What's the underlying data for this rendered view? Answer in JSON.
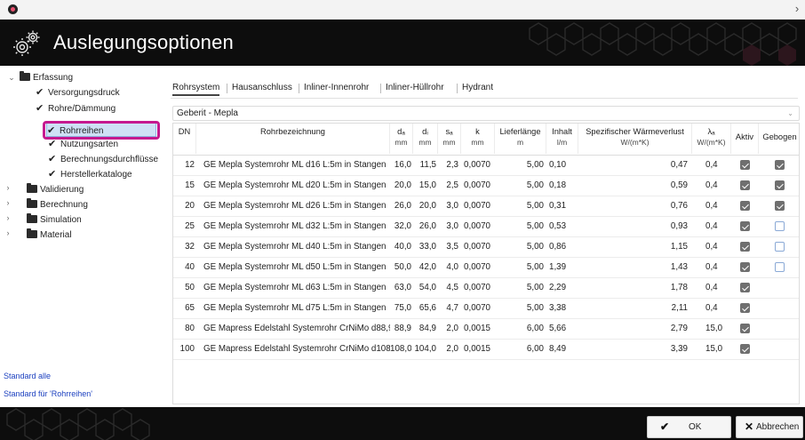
{
  "window": {
    "close_glyph": "›"
  },
  "header": {
    "title": "Auslegungsoptionen",
    "icon": "gears-icon"
  },
  "sidebar": {
    "tree": [
      {
        "label": "Erfassung",
        "type": "folder",
        "expanded": true,
        "level": 0
      },
      {
        "label": "Versorgungsdruck",
        "type": "check",
        "level": 1
      },
      {
        "label": "Rohre/Dämmung",
        "type": "check",
        "level": 1
      },
      {
        "label": "Rohrreihen",
        "type": "check",
        "level": 1,
        "selected": true
      },
      {
        "label": "Nutzungsarten",
        "type": "check",
        "level": 1
      },
      {
        "label": "Berechnungsdurchflüsse",
        "type": "check",
        "level": 1
      },
      {
        "label": "Herstellerkataloge",
        "type": "check",
        "level": 1
      },
      {
        "label": "Validierung",
        "type": "folder",
        "expanded": false,
        "level": 0
      },
      {
        "label": "Berechnung",
        "type": "folder",
        "expanded": false,
        "level": 0
      },
      {
        "label": "Simulation",
        "type": "folder",
        "expanded": false,
        "level": 0
      },
      {
        "label": "Material",
        "type": "folder",
        "expanded": false,
        "level": 0
      }
    ],
    "links": [
      "Standard alle",
      "Standard für 'Rohrreihen'"
    ]
  },
  "tabs": [
    "Rohrsystem",
    "Hausanschluss",
    "Inliner-Innenrohr",
    "Inliner-Hüllrohr",
    "Hydrant"
  ],
  "active_tab": "Rohrsystem",
  "combo": {
    "value": "Geberit - Mepla"
  },
  "table": {
    "headers": [
      {
        "top": "DN",
        "unit": ""
      },
      {
        "top": "Rohrbezeichnung",
        "unit": ""
      },
      {
        "top": "dₐ",
        "unit": "mm"
      },
      {
        "top": "dᵢ",
        "unit": "mm"
      },
      {
        "top": "sₐ",
        "unit": "mm"
      },
      {
        "top": "k",
        "unit": "mm"
      },
      {
        "top": "Lieferlänge",
        "unit": "m"
      },
      {
        "top": "Inhalt",
        "unit": "l/m"
      },
      {
        "top": "Spezifischer Wärmeverlust",
        "unit": "W/(m*K)"
      },
      {
        "top": "λₐ",
        "unit": "W/(m*K)"
      },
      {
        "top": "Aktiv",
        "unit": ""
      },
      {
        "top": "Gebogen",
        "unit": ""
      }
    ],
    "rows": [
      {
        "dn": "12",
        "name": "GE Mepla Systemrohr ML d16 L:5m in Stangen",
        "da": "16,0",
        "di": "11,5",
        "s": "2,3",
        "k": "0,0070",
        "len": "5,00",
        "vol": "0,10",
        "loss": "0,47",
        "lambda": "0,4",
        "aktiv": true,
        "gebogen": true
      },
      {
        "dn": "15",
        "name": "GE Mepla Systemrohr ML d20 L:5m in Stangen",
        "da": "20,0",
        "di": "15,0",
        "s": "2,5",
        "k": "0,0070",
        "len": "5,00",
        "vol": "0,18",
        "loss": "0,59",
        "lambda": "0,4",
        "aktiv": true,
        "gebogen": true
      },
      {
        "dn": "20",
        "name": "GE Mepla Systemrohr ML d26 L:5m in Stangen",
        "da": "26,0",
        "di": "20,0",
        "s": "3,0",
        "k": "0,0070",
        "len": "5,00",
        "vol": "0,31",
        "loss": "0,76",
        "lambda": "0,4",
        "aktiv": true,
        "gebogen": true
      },
      {
        "dn": "25",
        "name": "GE Mepla Systemrohr ML d32 L:5m in Stangen",
        "da": "32,0",
        "di": "26,0",
        "s": "3,0",
        "k": "0,0070",
        "len": "5,00",
        "vol": "0,53",
        "loss": "0,93",
        "lambda": "0,4",
        "aktiv": true,
        "gebogen": false
      },
      {
        "dn": "32",
        "name": "GE Mepla Systemrohr ML d40 L:5m in Stangen",
        "da": "40,0",
        "di": "33,0",
        "s": "3,5",
        "k": "0,0070",
        "len": "5,00",
        "vol": "0,86",
        "loss": "1,15",
        "lambda": "0,4",
        "aktiv": true,
        "gebogen": false
      },
      {
        "dn": "40",
        "name": "GE Mepla Systemrohr ML d50 L:5m in Stangen",
        "da": "50,0",
        "di": "42,0",
        "s": "4,0",
        "k": "0,0070",
        "len": "5,00",
        "vol": "1,39",
        "loss": "1,43",
        "lambda": "0,4",
        "aktiv": true,
        "gebogen": false
      },
      {
        "dn": "50",
        "name": "GE Mepla Systemrohr ML d63 L:5m in Stangen",
        "da": "63,0",
        "di": "54,0",
        "s": "4,5",
        "k": "0,0070",
        "len": "5,00",
        "vol": "2,29",
        "loss": "1,78",
        "lambda": "0,4",
        "aktiv": true,
        "gebogen": null
      },
      {
        "dn": "65",
        "name": "GE Mepla Systemrohr ML d75 L:5m in Stangen",
        "da": "75,0",
        "di": "65,6",
        "s": "4,7",
        "k": "0,0070",
        "len": "5,00",
        "vol": "3,38",
        "loss": "2,11",
        "lambda": "0,4",
        "aktiv": true,
        "gebogen": null
      },
      {
        "dn": "80",
        "name": "GE Mapress Edelstahl Systemrohr CrNiMo d88,9",
        "da": "88,9",
        "di": "84,9",
        "s": "2,0",
        "k": "0,0015",
        "len": "6,00",
        "vol": "5,66",
        "loss": "2,79",
        "lambda": "15,0",
        "aktiv": true,
        "gebogen": null
      },
      {
        "dn": "100",
        "name": "GE Mapress Edelstahl Systemrohr CrNiMo d108",
        "da": "108,0",
        "di": "104,0",
        "s": "2,0",
        "k": "0,0015",
        "len": "6,00",
        "vol": "8,49",
        "loss": "3,39",
        "lambda": "15,0",
        "aktiv": true,
        "gebogen": null
      }
    ]
  },
  "buttons": {
    "ok": "OK",
    "cancel": "Abbrechen"
  },
  "colors": {
    "accent_ring": "#c5198f",
    "header_bg": "#0d0d0d",
    "selection": "#cfe0f5",
    "link": "#1a3fbf"
  }
}
